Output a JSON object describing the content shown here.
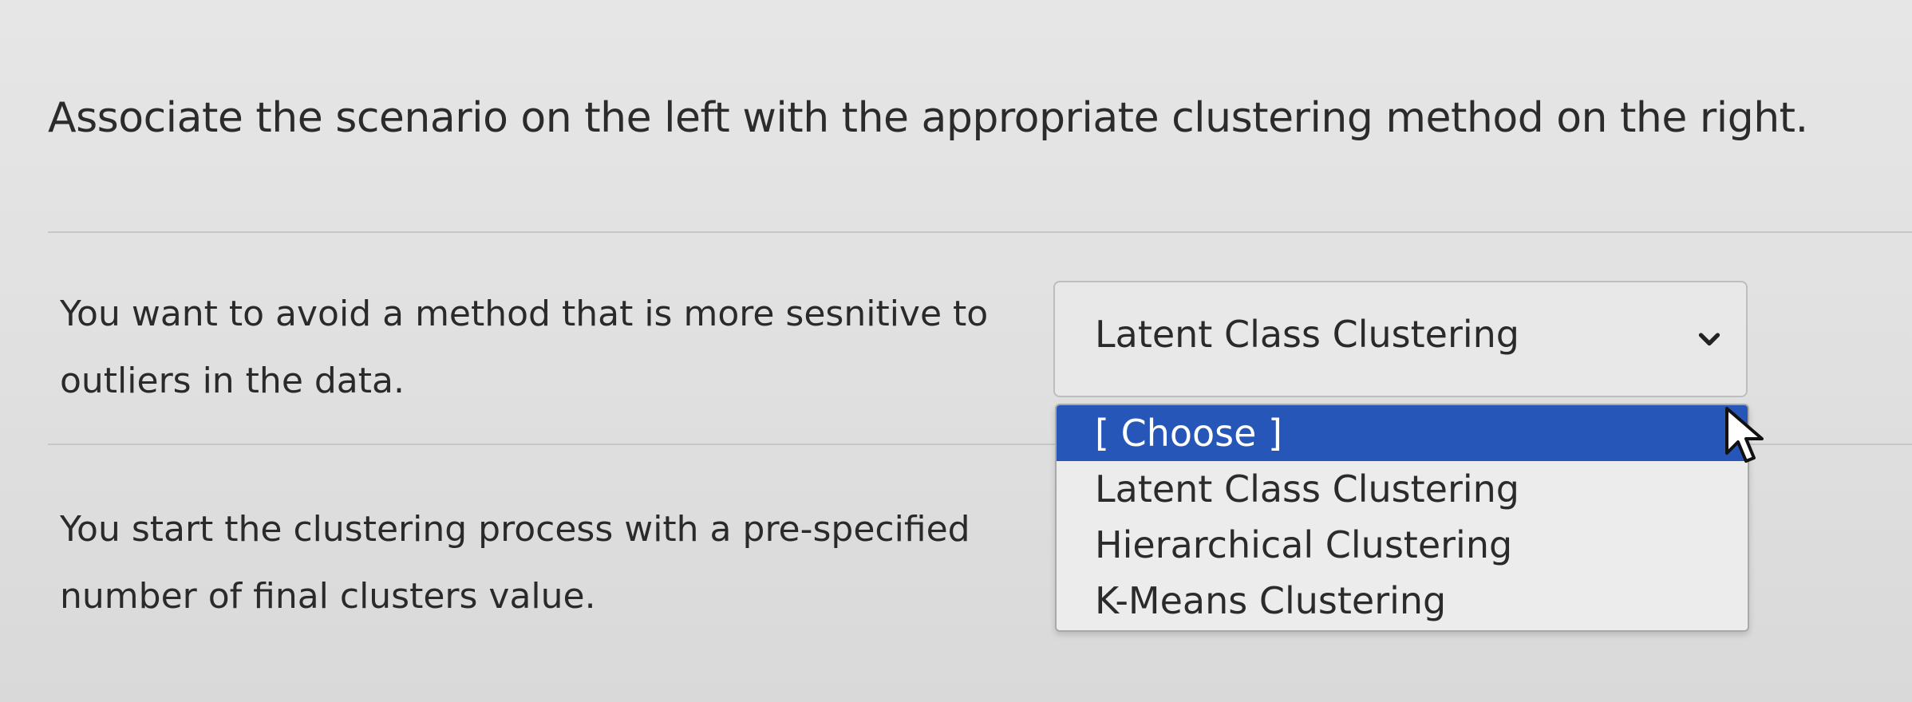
{
  "prompt": "Associate the scenario on the left with the appropriate clustering method on the right.",
  "rows": [
    {
      "scenario": "You want to avoid a method that is more sesnitive to outliers in the data.",
      "selected_value": "Latent Class Clustering"
    },
    {
      "scenario": "You start the clustering process with a pre-specified number of final clusters value."
    }
  ],
  "dropdown": {
    "options": [
      "[ Choose ]",
      "Latent Class Clustering",
      "Hierarchical Clustering",
      "K-Means Clustering"
    ],
    "highlighted_index": 0,
    "highlight_color": "#2656b8"
  },
  "icons": {
    "select_chevron": "chevron-down-icon",
    "pointer": "mouse-cursor-icon"
  }
}
